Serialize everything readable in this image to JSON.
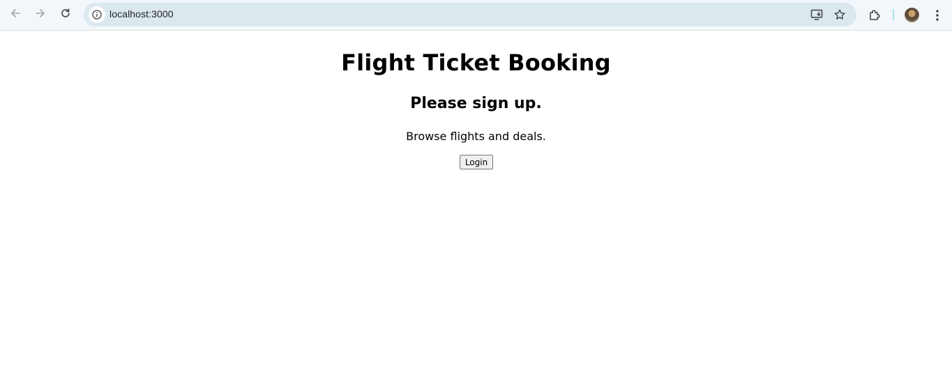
{
  "browser": {
    "url": "localhost:3000",
    "icons": {
      "back": "arrow-left-icon",
      "forward": "arrow-right-icon",
      "reload": "reload-icon",
      "site_info": "info-icon",
      "install": "install-app-icon",
      "bookmark": "star-icon",
      "extensions": "puzzle-icon",
      "profile": "avatar",
      "menu": "kebab-menu-icon"
    },
    "colors": {
      "toolbar_bg": "#f1f7fb",
      "omnibox_bg": "#dbe8ee"
    }
  },
  "page": {
    "title": "Flight Ticket Booking",
    "subtitle": "Please sign up.",
    "description": "Browse flights and deals.",
    "login_label": "Login"
  }
}
